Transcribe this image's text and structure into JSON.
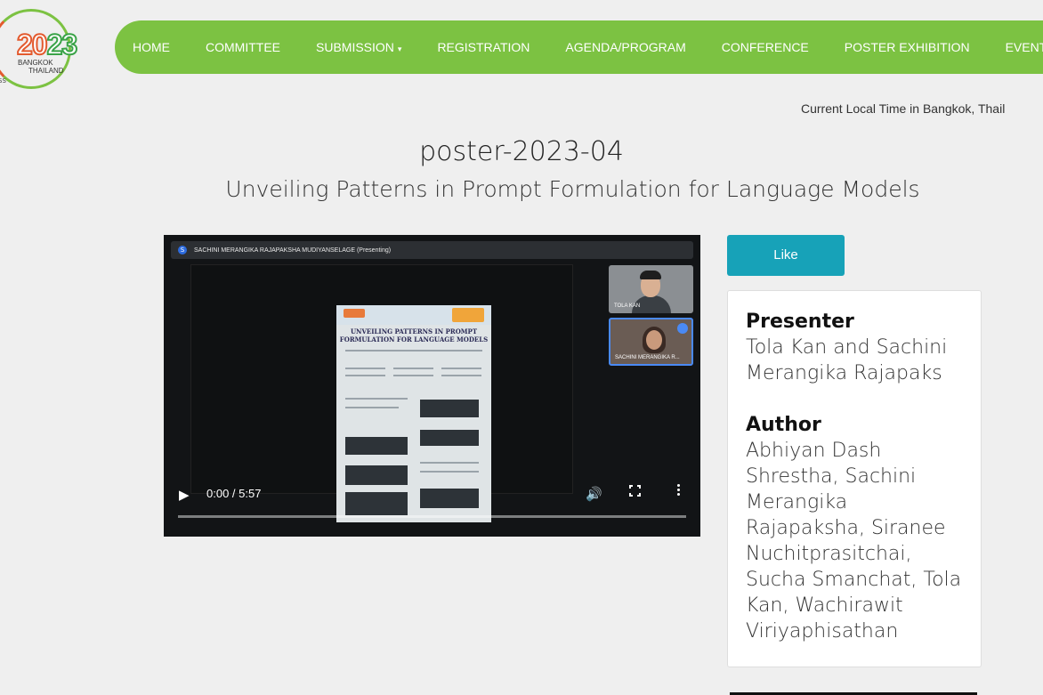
{
  "logo": {
    "year_a": "20",
    "year_b": "23",
    "city": "BANGKOK",
    "country": "THAILAND",
    "fragment": "SS"
  },
  "nav": {
    "items": [
      "HOME",
      "COMMITTEE",
      "SUBMISSION",
      "REGISTRATION",
      "AGENDA/PROGRAM",
      "CONFERENCE",
      "POSTER EXHIBITION",
      "EVENT HI"
    ],
    "submission_caret": "▾"
  },
  "localtime": "Current Local Time in Bangkok, Thail",
  "poster": {
    "id": "poster-2023-04",
    "title": "Unveiling Patterns in Prompt Formulation for Language Models"
  },
  "video": {
    "presenting_label": "SACHINI MERANGIKA RAJAPAKSHA MUDIYANSELAGE (Presenting)",
    "presenting_initial": "S",
    "slide_title": "UNVEILING PATTERNS IN PROMPT FORMULATION FOR LANGUAGE MODELS",
    "cam1_name": "TOLA KAN",
    "cam2_name": "SACHINI MERANGIKA R...",
    "time": "0:00 / 5:57",
    "progress": 0.0
  },
  "like_label": "Like",
  "presenter": {
    "heading": "Presenter",
    "text": "Tola Kan and Sachini Merangika Rajapaks"
  },
  "author": {
    "heading": "Author",
    "text": "Abhiyan Dash Shrestha, Sachini Merangika Rajapaksha, Siranee Nuchitprasitchai, Sucha Smanchat, Tola Kan, Wachirawit Viriyaphisathan"
  },
  "colors": {
    "nav": "#7cc242",
    "like": "#17a2b8",
    "logo_orange": "#e35a2e"
  }
}
